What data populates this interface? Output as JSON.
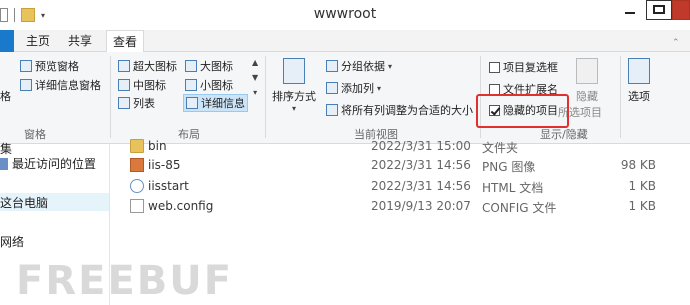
{
  "window": {
    "title": "wwwroot"
  },
  "tabs": {
    "home": "主页",
    "share": "共享",
    "view": "查看"
  },
  "ribbon": {
    "pane_group": {
      "navigation_pane_fragment": "格",
      "preview_pane": "预览窗格",
      "details_pane": "详细信息窗格",
      "label": "窗格"
    },
    "layout_group": {
      "extra_large_icons": "超大图标",
      "large_icons": "大图标",
      "medium_icons": "中图标",
      "small_icons": "小图标",
      "list": "列表",
      "details": "详细信息",
      "label": "布局"
    },
    "current_view_group": {
      "sort_by": "排序方式",
      "group_by": "分组依据",
      "add_columns": "添加列",
      "size_all_columns": "将所有列调整为合适的大小",
      "label": "当前视图"
    },
    "show_hide_group": {
      "item_checkboxes": "项目复选框",
      "file_name_extensions": "文件扩展名",
      "hidden_items": "隐藏的项目",
      "hidden_items_checked": true,
      "hide_selected_fragment_top": "隐藏",
      "hide_selected_fragment_bottom": "所选项目",
      "label": "显示/隐藏"
    },
    "options": "选项"
  },
  "nav": {
    "item_top_fragment": "集",
    "recent_places": "最近访问的位置",
    "this_pc": "这台电脑",
    "network": "网络"
  },
  "files": [
    {
      "name": "bin",
      "date": "2022/3/31 15:00",
      "type": "文件夹",
      "size": "",
      "icon": "folder-icon"
    },
    {
      "name": "iis-85",
      "date": "2022/3/31 14:56",
      "type": "PNG 图像",
      "size": "98 KB",
      "icon": "png-file-icon"
    },
    {
      "name": "iisstart",
      "date": "2022/3/31 14:56",
      "type": "HTML 文档",
      "size": "1 KB",
      "icon": "html-file-icon"
    },
    {
      "name": "web.config",
      "date": "2019/9/13 20:07",
      "type": "CONFIG 文件",
      "size": "1 KB",
      "icon": "config-file-icon"
    }
  ],
  "watermark": "FREEBUF"
}
